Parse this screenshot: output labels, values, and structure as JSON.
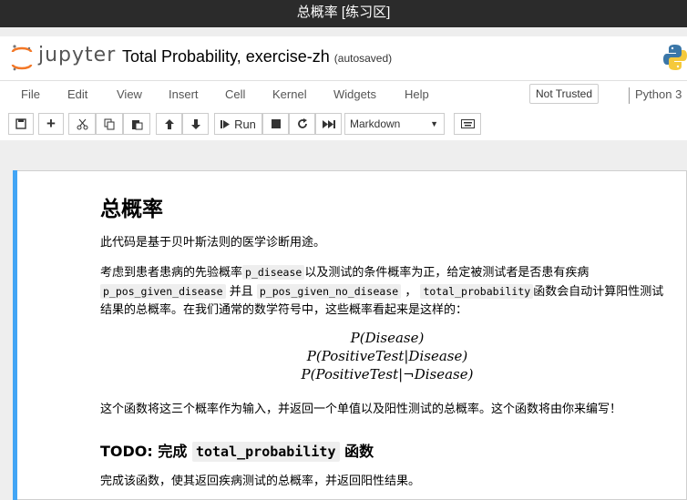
{
  "window": {
    "title": "总概率 [练习区]"
  },
  "header": {
    "logo_text": "jupyter",
    "notebook_name": "Total Probability, exercise-zh",
    "save_status": "(autosaved)"
  },
  "menu": {
    "items": [
      "File",
      "Edit",
      "View",
      "Insert",
      "Cell",
      "Kernel",
      "Widgets",
      "Help"
    ],
    "trust_label": "Not Trusted",
    "kernel_name": "Python 3"
  },
  "toolbar": {
    "run_label": "Run",
    "cell_type": "Markdown"
  },
  "cell": {
    "title": "总概率",
    "intro": "此代码是基于贝叶斯法则的医学诊断用途。",
    "p2_a": "考虑到患者患病的先验概率",
    "code_p_disease": "p_disease",
    "p2_b": "以及测试的条件概率为正，给定被测试者是否患有疾病",
    "code_p_pos_given_disease": "p_pos_given_disease",
    "p2_c": "并且",
    "code_p_pos_given_no_disease": "p_pos_given_no_disease",
    "p2_d": "，",
    "code_total_probability": "total_probability",
    "p2_e": "函数会自动计算阳性测试结果的总概率。在我们通常的数学符号中，这些概率看起来是这样的：",
    "math_1": "P(Disease)",
    "math_2": "P(PositiveTest|Disease)",
    "math_3": "P(PositiveTest|¬Disease)",
    "p3": "这个函数将这三个概率作为输入，并返回一个单值以及阳性测试的总概率。这个函数将由你来编写！",
    "todo_a": "TODO:",
    "todo_b": "完成",
    "todo_code": "total_probability",
    "todo_c": "函数",
    "p4": "完成该函数，使其返回疾病测试的总概率，并返回阳性结果。"
  }
}
